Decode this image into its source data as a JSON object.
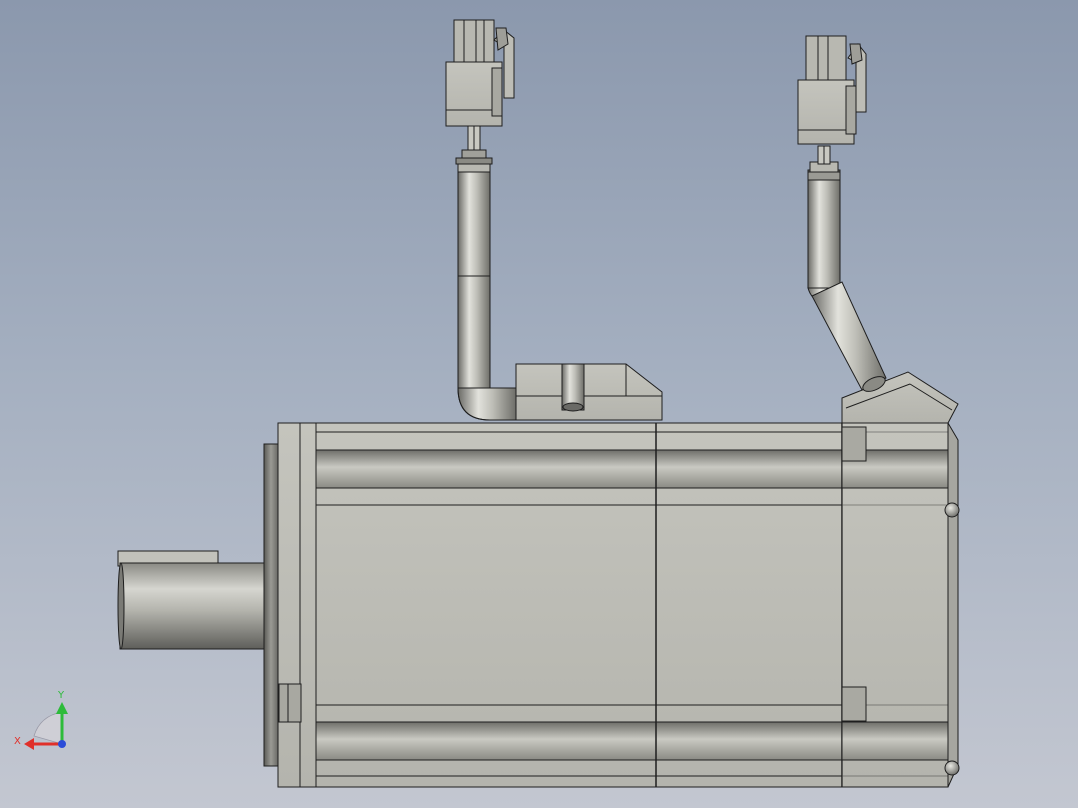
{
  "colors": {
    "body": "#bfbfb8",
    "edge": "#1e1e1e",
    "x_axis": "#e0302a",
    "y_axis": "#2dbb3a",
    "z_axis": "#2b4cd8"
  },
  "triad": {
    "x_label": "X",
    "y_label": "Y"
  },
  "icons": [
    "coordinate-triad-icon"
  ]
}
